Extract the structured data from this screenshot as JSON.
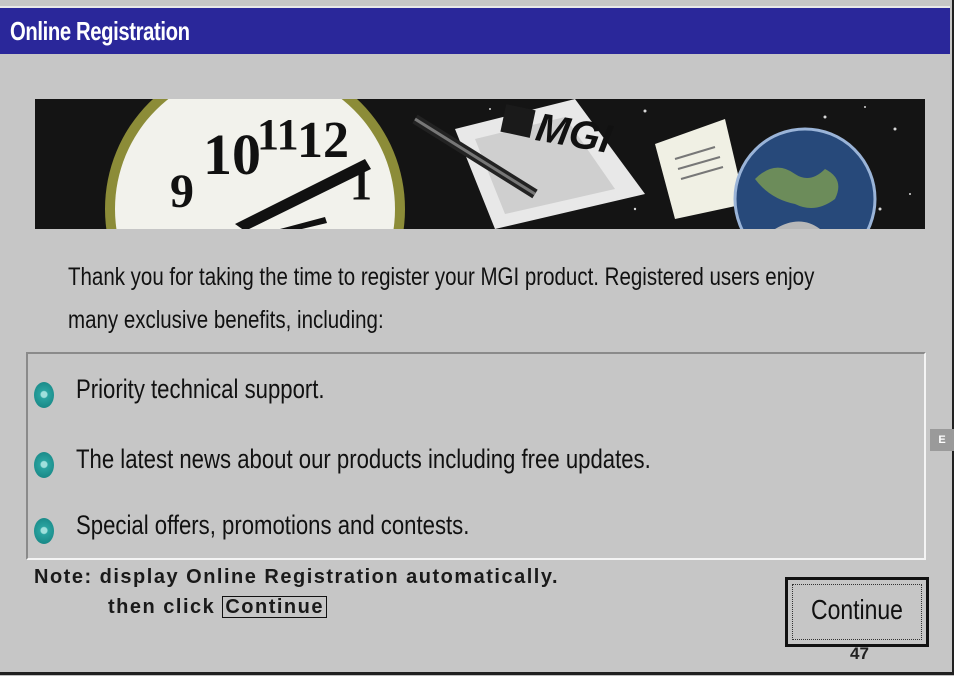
{
  "window": {
    "title": "Online Registration"
  },
  "banner": {
    "brand_text": "MGI",
    "clock_numerals": [
      "10",
      "11",
      "12",
      "9",
      "1"
    ]
  },
  "intro": {
    "line1": "Thank you for taking the time to register your MGI product.  Registered users enjoy",
    "line2": "many exclusive benefits, including:"
  },
  "benefits": [
    {
      "label": "Priority technical support."
    },
    {
      "label": "The latest news about our products including free updates."
    },
    {
      "label": "Special offers, promotions and contests."
    }
  ],
  "note": {
    "line1": "Note: display Online Registration automatically.",
    "line2_prefix": "then click",
    "line2_button": "Continue"
  },
  "buttons": {
    "continue_label": "Continue"
  },
  "page": {
    "number": "47",
    "side_tab": "E"
  },
  "colors": {
    "titlebar": "#2a279a",
    "bullet": "#2aa3a0",
    "window_bg": "#c6c6c6"
  }
}
